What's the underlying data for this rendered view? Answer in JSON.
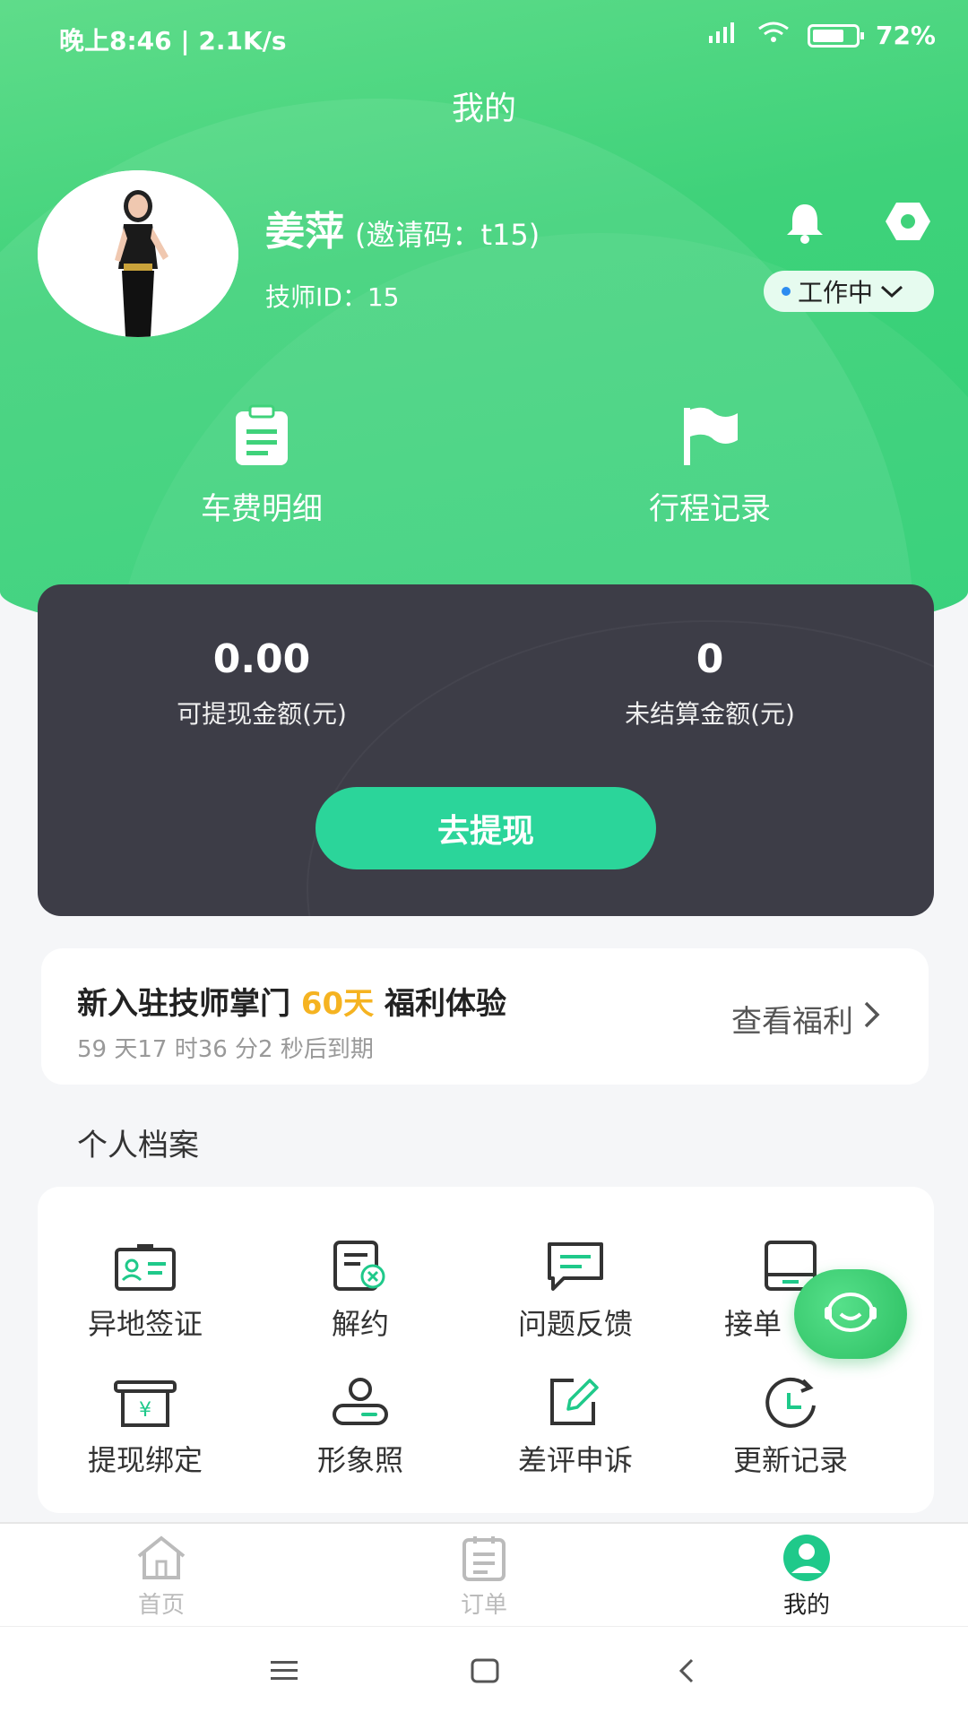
{
  "status_bar": {
    "time": "晚上8:46 | 2.1K/s",
    "battery": "72%"
  },
  "header": {
    "title": "我的"
  },
  "profile": {
    "name": "姜萍",
    "invite_code": "(邀请码：t15)",
    "tech_id": "技师ID：15",
    "work_status": "工作中"
  },
  "quick_links": [
    {
      "label": "车费明细",
      "icon": "clipboard-icon"
    },
    {
      "label": "行程记录",
      "icon": "flag-icon"
    }
  ],
  "wallet": {
    "withdrawable_value": "0.00",
    "withdrawable_label": "可提现金额(元)",
    "unsettled_value": "0",
    "unsettled_label": "未结算金额(元)",
    "withdraw_button": "去提现"
  },
  "promo": {
    "title_prefix": "新入驻技师掌门 ",
    "title_highlight": "60天",
    "title_suffix": " 福利体验",
    "countdown": "59 天17 时36 分2 秒后到期",
    "link_label": "查看福利"
  },
  "archive": {
    "section_title": "个人档案",
    "items": [
      {
        "label": "异地签证",
        "icon": "id-card-icon"
      },
      {
        "label": "解约",
        "icon": "document-cancel-icon"
      },
      {
        "label": "问题反馈",
        "icon": "chat-bubble-icon"
      },
      {
        "label": "接单",
        "icon": "tablet-icon"
      },
      {
        "label": "提现绑定",
        "icon": "cash-register-icon"
      },
      {
        "label": "形象照",
        "icon": "user-toggle-icon"
      },
      {
        "label": "差评申诉",
        "icon": "edit-icon"
      },
      {
        "label": "更新记录",
        "icon": "clock-refresh-icon"
      }
    ]
  },
  "tabbar": {
    "tabs": [
      {
        "label": "首页",
        "icon": "home-icon"
      },
      {
        "label": "订单",
        "icon": "orders-icon"
      },
      {
        "label": "我的",
        "icon": "profile-icon"
      }
    ]
  },
  "colors": {
    "brand_green": "#3fd27a",
    "wallet_bg": "#3d3d47",
    "withdraw_btn": "#2bd59a",
    "highlight": "#f5b321"
  }
}
